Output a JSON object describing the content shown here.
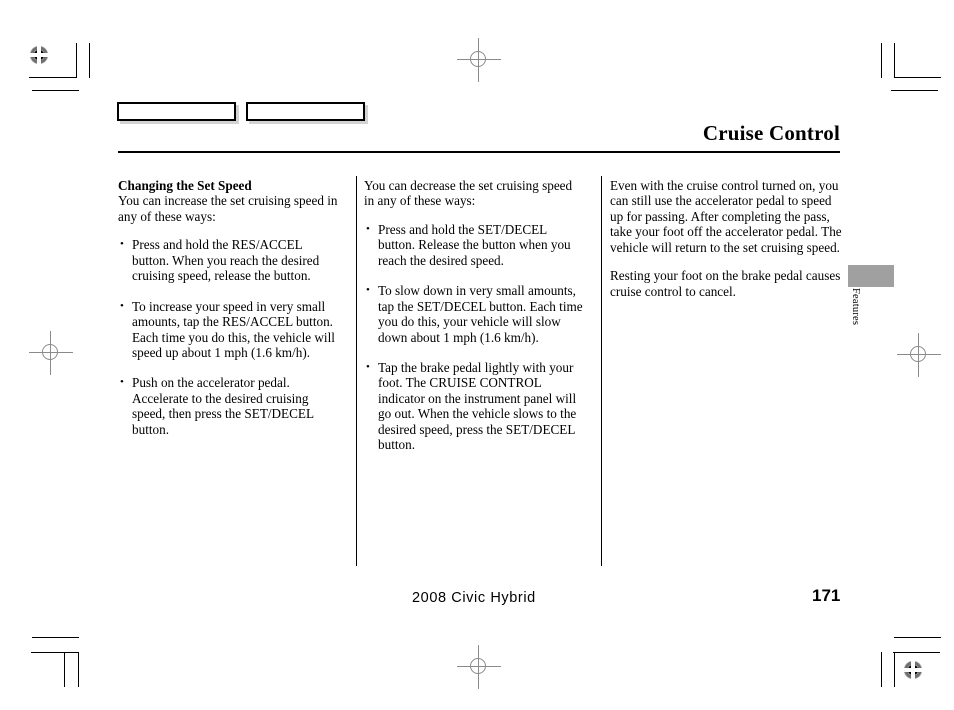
{
  "header": {
    "title": "Cruise Control"
  },
  "side_tab": {
    "label": "Features",
    "color": "#a0a0a0"
  },
  "columns": [
    {
      "heading": "Changing the Set Speed",
      "intro": "You can increase the set cruising speed in any of these ways:",
      "bullets": [
        "Press and hold the RES/ACCEL button. When you reach the desired cruising speed, release the button.",
        "To increase your speed in very small amounts, tap the RES/ACCEL button. Each time you do this, the vehicle will speed up about 1 mph (1.6 km/h).",
        "Push on the accelerator pedal. Accelerate to the desired cruising speed, then press the SET/DECEL button."
      ]
    },
    {
      "intro": "You can decrease the set cruising speed in any of these ways:",
      "bullets": [
        "Press and hold the SET/DECEL button. Release the button when you reach the desired speed.",
        "To slow down in very small amounts, tap the SET/DECEL button. Each time you do this, your vehicle will slow down about 1 mph (1.6 km/h).",
        "Tap the brake pedal lightly with your foot. The CRUISE CONTROL indicator on the instrument panel will go out. When the vehicle slows to the desired speed, press the SET/DECEL button."
      ]
    },
    {
      "paragraphs": [
        "Even with the cruise control turned on, you can still use the accelerator pedal to speed up for passing. After completing the pass, take your foot off the accelerator pedal. The vehicle will return to the set cruising speed.",
        "Resting your foot on the brake pedal causes cruise control to cancel."
      ]
    }
  ],
  "footer": {
    "model": "2008  Civic  Hybrid",
    "page_number": "171"
  }
}
